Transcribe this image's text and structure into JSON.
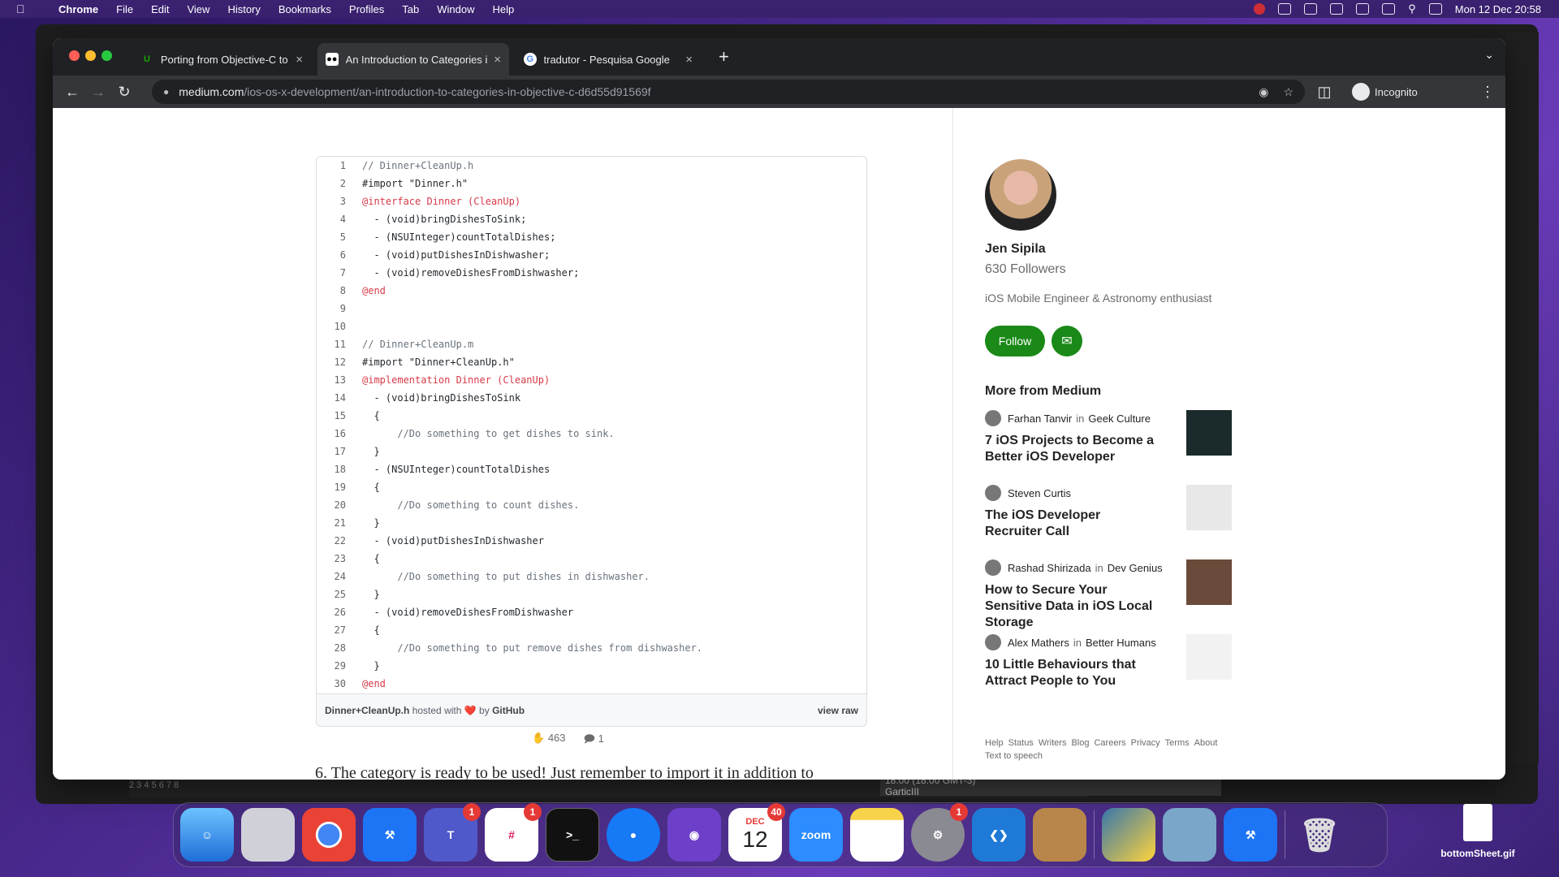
{
  "menubar": {
    "app": "Chrome",
    "items": [
      "File",
      "Edit",
      "View",
      "History",
      "Bookmarks",
      "Profiles",
      "Tab",
      "Window",
      "Help"
    ],
    "datetime": "Mon 12 Dec  20:58"
  },
  "tabs": [
    {
      "title": "Porting from Objective-C to Sw",
      "icon": "upwork-icon",
      "active": false
    },
    {
      "title": "An Introduction to Categories i",
      "icon": "medium-icon",
      "active": true
    },
    {
      "title": "tradutor - Pesquisa Google",
      "icon": "google-icon",
      "active": false
    }
  ],
  "toolbar": {
    "url_host": "medium.com",
    "url_path": "/ios-os-x-development/an-introduction-to-categories-in-objective-c-d6d55d91569f",
    "profile": "Incognito"
  },
  "gist": {
    "lines": [
      "// Dinner+CleanUp.h",
      "#import \"Dinner.h\"",
      "@interface Dinner (CleanUp)",
      "  - (void)bringDishesToSink;",
      "  - (NSUInteger)countTotalDishes;",
      "  - (void)putDishesInDishwasher;",
      "  - (void)removeDishesFromDishwasher;",
      "@end",
      "",
      "",
      "// Dinner+CleanUp.m",
      "#import \"Dinner+CleanUp.h\"",
      "@implementation Dinner (CleanUp)",
      "  - (void)bringDishesToSink",
      "  {",
      "      //Do something to get dishes to sink.",
      "  }",
      "  - (NSUInteger)countTotalDishes",
      "  {",
      "      //Do something to count dishes.",
      "  }",
      "  - (void)putDishesInDishwasher",
      "  {",
      "      //Do something to put dishes in dishwasher.",
      "  }",
      "  - (void)removeDishesFromDishwasher",
      "  {",
      "      //Do something to put remove dishes from dishwasher.",
      "  }",
      "@end"
    ],
    "filename": "Dinner+CleanUp.h",
    "hosted_with": "hosted with",
    "heart": "❤️",
    "by": "by",
    "github": "GitHub",
    "view_raw": "view raw"
  },
  "article": {
    "claps": "463",
    "responses": "1",
    "next_paragraph": "6. The category is ready to be used! Just remember to import it in addition to"
  },
  "author": {
    "name": "Jen Sipila",
    "followers": "630 Followers",
    "bio": "iOS Mobile Engineer & Astronomy enthusiast",
    "follow_label": "Follow"
  },
  "more": {
    "heading": "More from Medium",
    "stories": [
      {
        "author": "Farhan Tanvir",
        "in": "in",
        "pub": "Geek Culture",
        "title": "7 iOS Projects to Become a Better iOS Developer"
      },
      {
        "author": "Steven Curtis",
        "in": "",
        "pub": "",
        "title": "The iOS Developer Recruiter Call"
      },
      {
        "author": "Rashad Shirizada",
        "in": "in",
        "pub": "Dev Genius",
        "title": "How to Secure Your Sensitive Data in iOS Local Storage"
      },
      {
        "author": "Alex Mathers",
        "in": "in",
        "pub": "Better Humans",
        "title": "10 Little Behaviours that Attract People to You"
      }
    ]
  },
  "footer_links": [
    "Help",
    "Status",
    "Writers",
    "Blog",
    "Careers",
    "Privacy",
    "Terms",
    "About",
    "Text to speech"
  ],
  "background": {
    "event": "18:00 (18:00 GMT-3)",
    "event2": "GarticIII",
    "strip_numbers": "2  3  4  5  6  7  8"
  },
  "dock": {
    "calendar_month": "DEC",
    "calendar_day": "12",
    "zoom_label": "zoom",
    "badges": {
      "teams": "1",
      "slack": "1",
      "calendar": "40",
      "settings": "1"
    }
  },
  "desktop_file": "bottomSheet.gif"
}
